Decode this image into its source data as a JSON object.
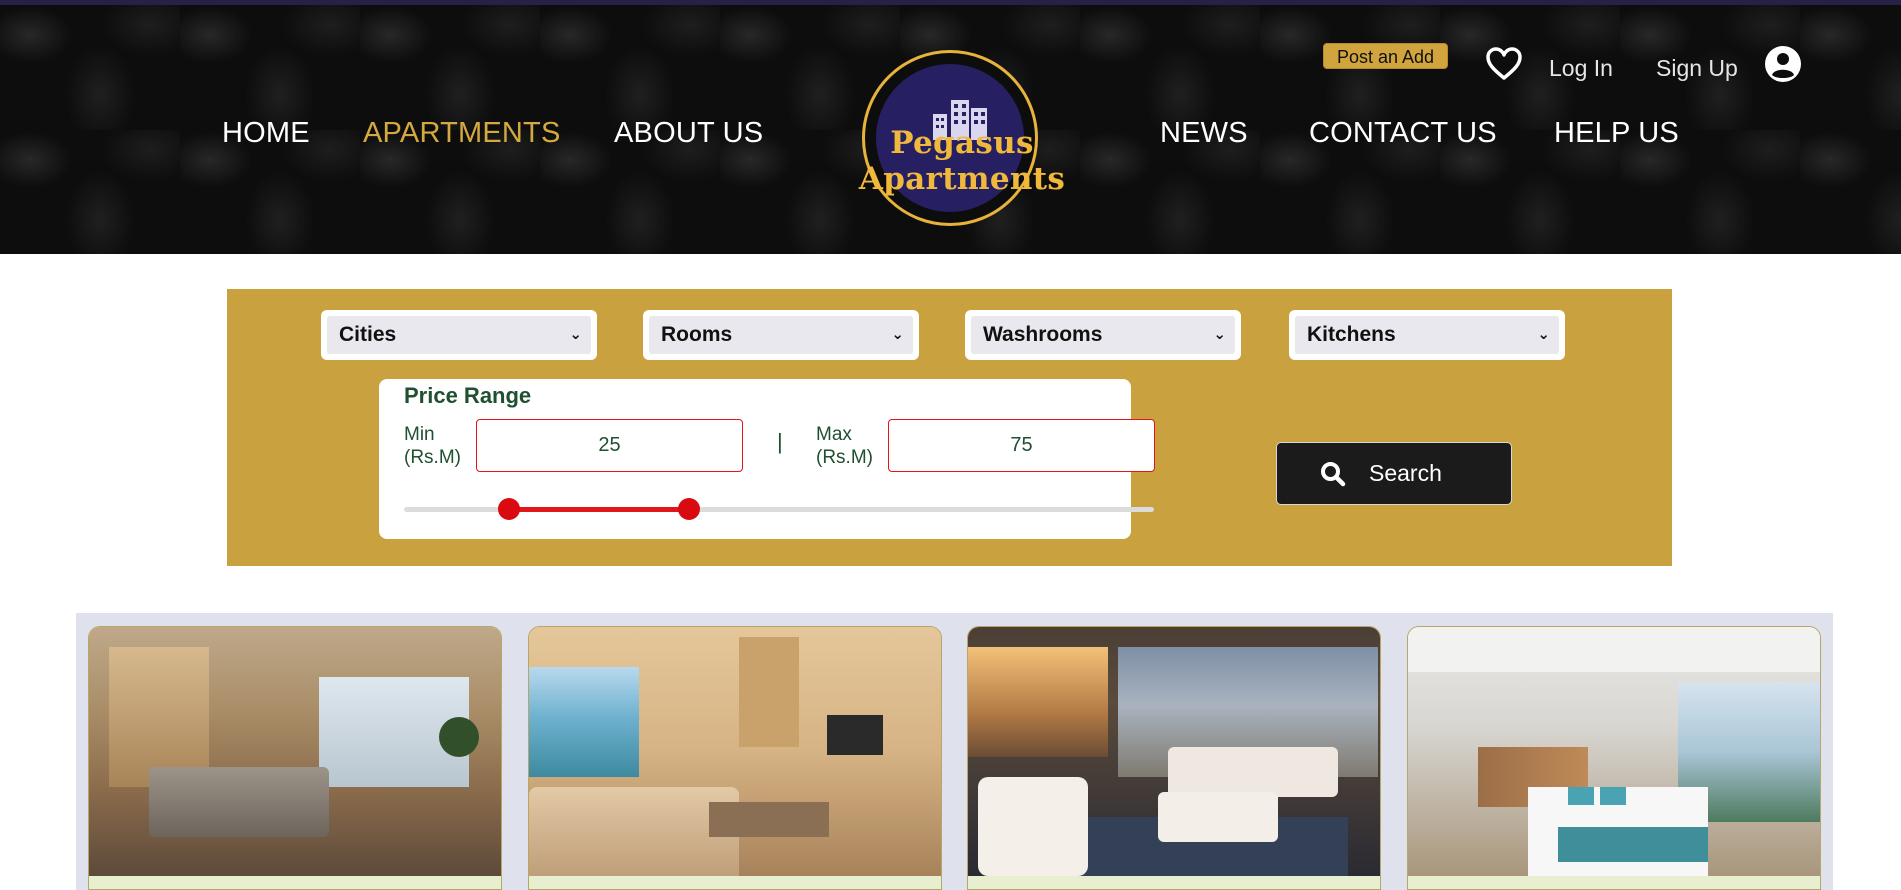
{
  "header": {
    "nav_left": [
      "HOME",
      "APARTMENTS",
      "ABOUT US"
    ],
    "nav_right": [
      "NEWS",
      "CONTACT US",
      "HELP US"
    ],
    "active_nav": "APARTMENTS",
    "logo_text": "Pegasus Apartments",
    "post_add_label": "Post an Add",
    "login_label": "Log In",
    "signup_label": "Sign Up",
    "icons": [
      "heart-icon",
      "user-icon",
      "building-icon"
    ]
  },
  "filters": {
    "cities": "Cities",
    "rooms": "Rooms",
    "washrooms": "Washrooms",
    "kitchens": "Kitchens"
  },
  "price": {
    "title": "Price Range",
    "min_label": "Min\n(Rs.M)",
    "max_label": "Max\n(Rs.M)",
    "min_value": "25",
    "max_value": "75",
    "separator": "|",
    "slider_min_fraction": 0.14,
    "slider_max_fraction": 0.38
  },
  "search": {
    "label": "Search",
    "icon": "search-icon"
  },
  "listings": [
    {
      "photo": "bedroom-with-city-view"
    },
    {
      "photo": "living-room-with-sea-view"
    },
    {
      "photo": "lounge-with-city-view"
    },
    {
      "photo": "bedroom-with-sea-view"
    }
  ],
  "colors": {
    "gold": "#c9a23f",
    "accent": "#d4a93f",
    "logo_navy": "#262063",
    "slider_red": "#e0161b",
    "text_green": "#1f5030"
  }
}
